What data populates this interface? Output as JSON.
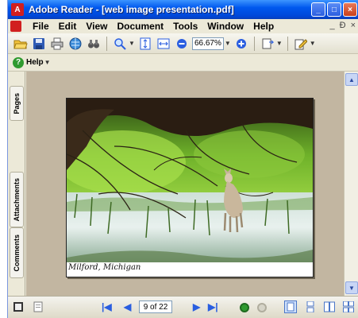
{
  "window": {
    "title": "Adobe Reader - [web image presentation.pdf]"
  },
  "menubar": {
    "items": [
      "File",
      "Edit",
      "View",
      "Document",
      "Tools",
      "Window",
      "Help"
    ],
    "doc_controls": [
      "_",
      "Ɖ",
      "×"
    ]
  },
  "toolbar": {
    "zoom_value": "66.67%"
  },
  "helpbar": {
    "help_label": "Help"
  },
  "sidebar": {
    "tabs": [
      "Pages",
      "Attachments",
      "Comments"
    ]
  },
  "document": {
    "caption": "Milford, Michigan"
  },
  "statusbar": {
    "page_indicator": "9 of 22"
  },
  "colors": {
    "titlebar": "#0058ee",
    "background": "#c2b6a1",
    "chrome": "#ece9d8"
  }
}
